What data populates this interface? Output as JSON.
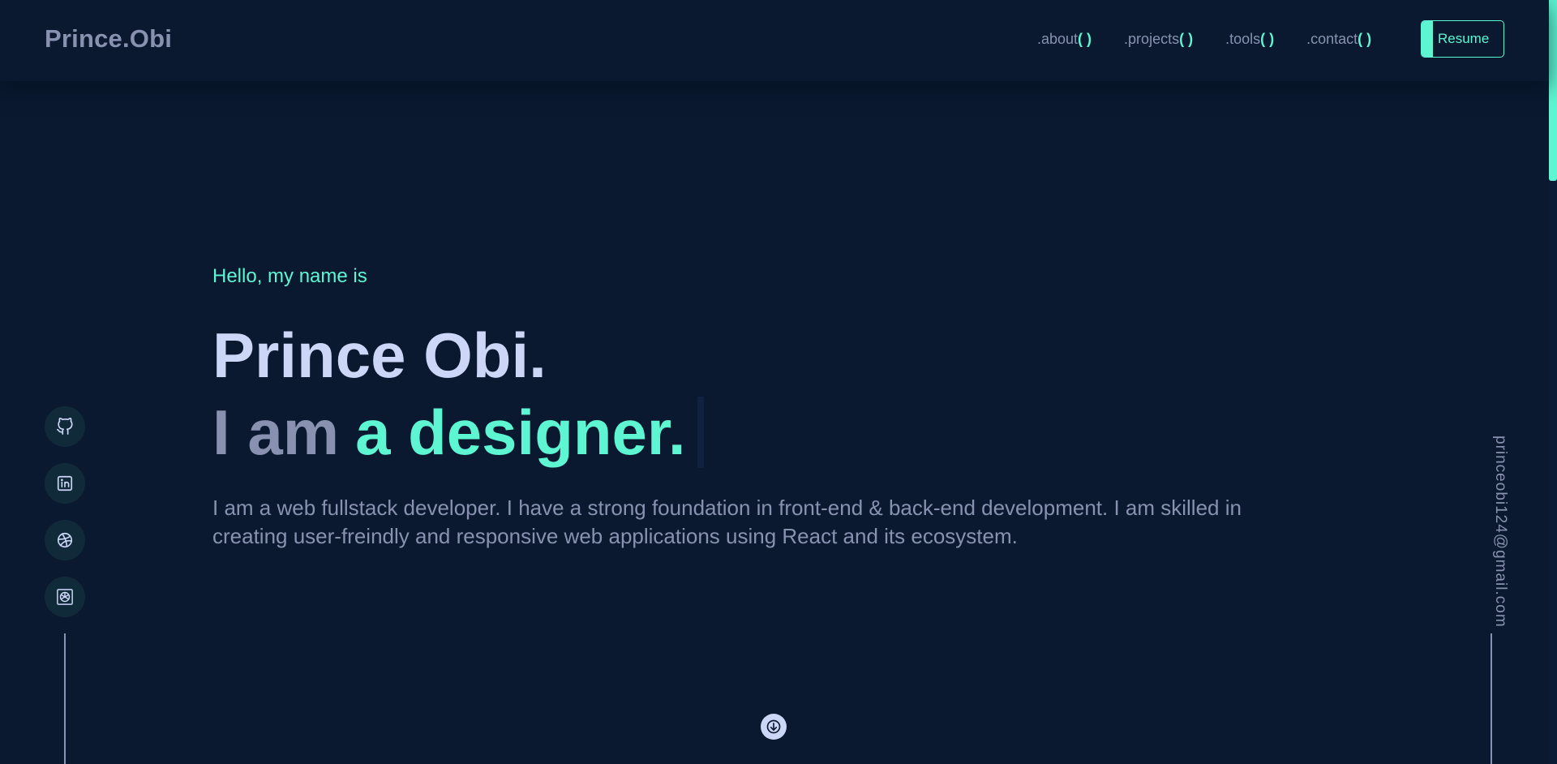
{
  "header": {
    "logo": "Prince.Obi",
    "nav": [
      {
        "label": ".about",
        "paren": "( )"
      },
      {
        "label": ".projects",
        "paren": "( )"
      },
      {
        "label": ".tools",
        "paren": "( )"
      },
      {
        "label": ".contact",
        "paren": "( )"
      }
    ],
    "resume_label": "Resume"
  },
  "hero": {
    "greeting": "Hello, my name is",
    "name": "Prince Obi.",
    "role_prefix": "I am",
    "role_word": "a designer.",
    "bio": "I am a web fullstack developer. I have a strong foundation in front-end & back-end development. I am skilled in creating user-freindly and responsive web applications using React and its ecosystem."
  },
  "social": [
    {
      "icon": "github-icon"
    },
    {
      "icon": "linkedin-icon"
    },
    {
      "icon": "dribbble-icon"
    },
    {
      "icon": "openai-icon"
    }
  ],
  "email": "princeobi124@gmail.com",
  "colors": {
    "background": "#0a192f",
    "accent": "#5ef5d2",
    "text_muted": "#8892b0",
    "text_light": "#ccd6f6"
  }
}
